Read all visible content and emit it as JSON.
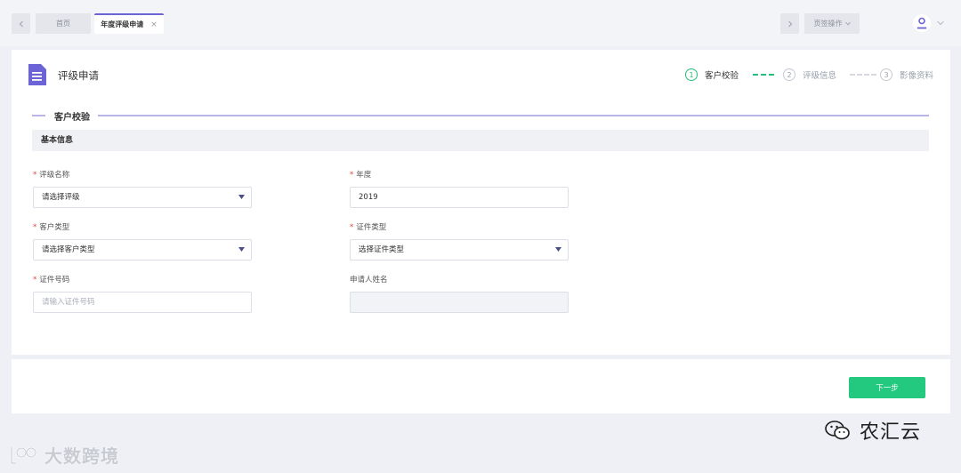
{
  "topbar": {
    "tabs": [
      {
        "label": "首页"
      },
      {
        "label": "年度评级申请",
        "close": "×"
      }
    ],
    "page_ops_label": "页签操作"
  },
  "header": {
    "title": "评级申请",
    "steps": [
      {
        "num": "1",
        "label": "客户校验",
        "state": "active"
      },
      {
        "num": "2",
        "label": "评级信息",
        "state": "pending"
      },
      {
        "num": "3",
        "label": "影像资料",
        "state": "pending"
      }
    ]
  },
  "section": {
    "title": "客户校验",
    "subtitle": "基本信息"
  },
  "form": {
    "rating_name": {
      "label": "评级名称",
      "placeholder": "请选择评级"
    },
    "year": {
      "label": "年度",
      "value": "2019"
    },
    "customer_type": {
      "label": "客户类型",
      "placeholder": "请选择客户类型"
    },
    "id_type": {
      "label": "证件类型",
      "placeholder": "选择证件类型"
    },
    "id_number": {
      "label": "证件号码",
      "placeholder": "请输入证件号码"
    },
    "applicant_name": {
      "label": "申请人姓名",
      "value": ""
    },
    "required_mark": "*"
  },
  "footer": {
    "next_label": "下一步"
  },
  "watermarks": {
    "left_text": "大数跨境",
    "right_text": "农汇云"
  },
  "colors": {
    "accent": "#6b63d6",
    "success": "#22c97e",
    "required": "#e2463b",
    "background": "#eef0f5"
  }
}
